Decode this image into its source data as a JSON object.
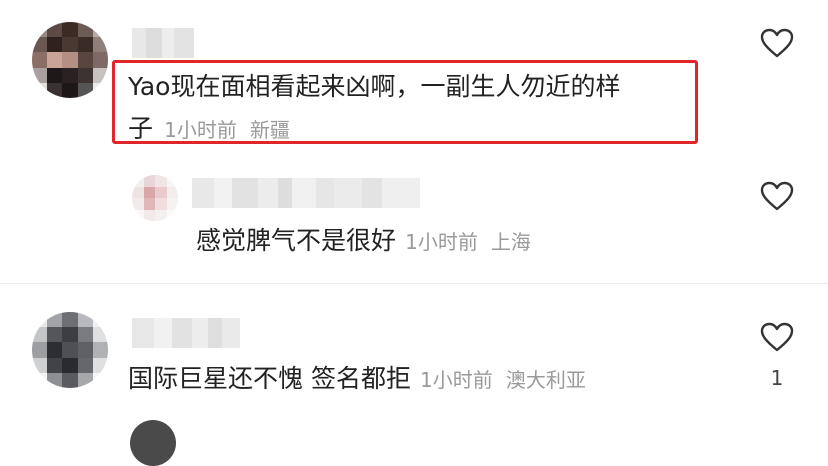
{
  "comments": [
    {
      "text_line1": "Yao现在面相看起来凶啊，一副生人勿近的样",
      "text_line2": "子",
      "time": "1小时前",
      "location": "新疆",
      "highlighted": true,
      "highlight_color": "#e0252b"
    },
    {
      "text": "感觉脾气不是很好",
      "time": "1小时前",
      "location": "上海",
      "is_reply": true
    },
    {
      "text": "国际巨星还不愧 签名都拒",
      "time": "1小时前",
      "location": "澳大利亚",
      "likes": "1"
    }
  ],
  "icons": {
    "like": "heart-outline-icon"
  },
  "colors": {
    "text": "#222222",
    "meta": "#9a9a9a",
    "highlight": "#e0252b"
  }
}
